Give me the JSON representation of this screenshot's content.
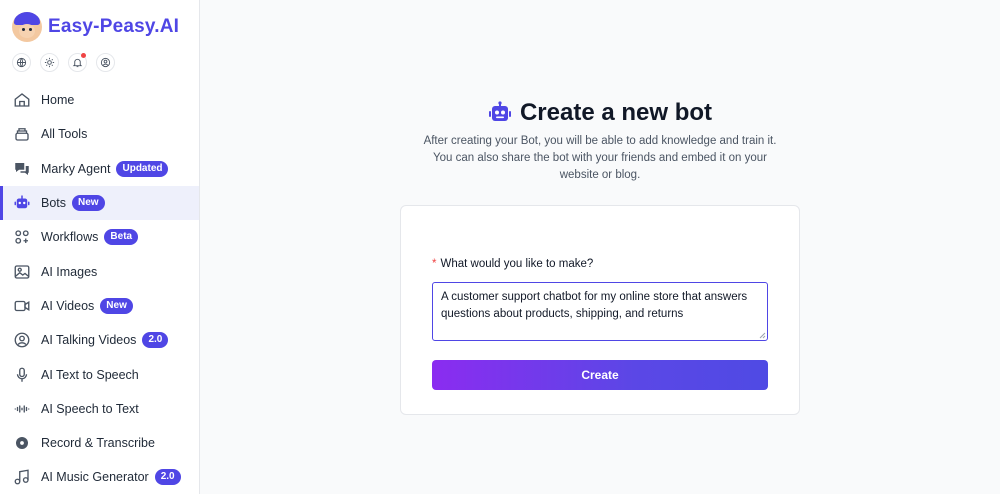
{
  "brand": {
    "name": "Easy-Peasy.AI"
  },
  "header_icons": [
    {
      "name": "globe-icon"
    },
    {
      "name": "sun-icon"
    },
    {
      "name": "bell-icon"
    },
    {
      "name": "user-circle-icon"
    }
  ],
  "sidebar": {
    "items": [
      {
        "label": "Home",
        "icon": "home-icon",
        "badge": ""
      },
      {
        "label": "All Tools",
        "icon": "layers-icon",
        "badge": ""
      },
      {
        "label": "Marky Agent",
        "icon": "chat-icon",
        "badge": "Updated"
      },
      {
        "label": "Bots",
        "icon": "robot-icon",
        "badge": "New",
        "active": true
      },
      {
        "label": "Workflows",
        "icon": "workflow-icon",
        "badge": "Beta"
      },
      {
        "label": "AI Images",
        "icon": "image-icon",
        "badge": ""
      },
      {
        "label": "AI Videos",
        "icon": "video-icon",
        "badge": "New"
      },
      {
        "label": "AI Talking Videos",
        "icon": "avatar-icon",
        "badge": "2.0"
      },
      {
        "label": "AI Text to Speech",
        "icon": "microphone-icon",
        "badge": ""
      },
      {
        "label": "AI Speech to Text",
        "icon": "waveform-icon",
        "badge": ""
      },
      {
        "label": "Record & Transcribe",
        "icon": "record-icon",
        "badge": ""
      },
      {
        "label": "AI Music Generator",
        "icon": "music-icon",
        "badge": "2.0"
      }
    ]
  },
  "main": {
    "title": "Create a new bot",
    "subtitle": "After creating your Bot, you will be able to add knowledge and train it. You can also share the bot with your friends and embed it on your website or blog.",
    "form": {
      "required_mark": "*",
      "label": "What would you like to make?",
      "value": "A customer support chatbot for my online store that answers questions about products, shipping, and returns",
      "submit_label": "Create"
    }
  },
  "colors": {
    "accent": "#4f46e5",
    "button_gradient_start": "#8b2cf0",
    "button_gradient_end": "#4f4ae4",
    "required": "#ef4444"
  }
}
